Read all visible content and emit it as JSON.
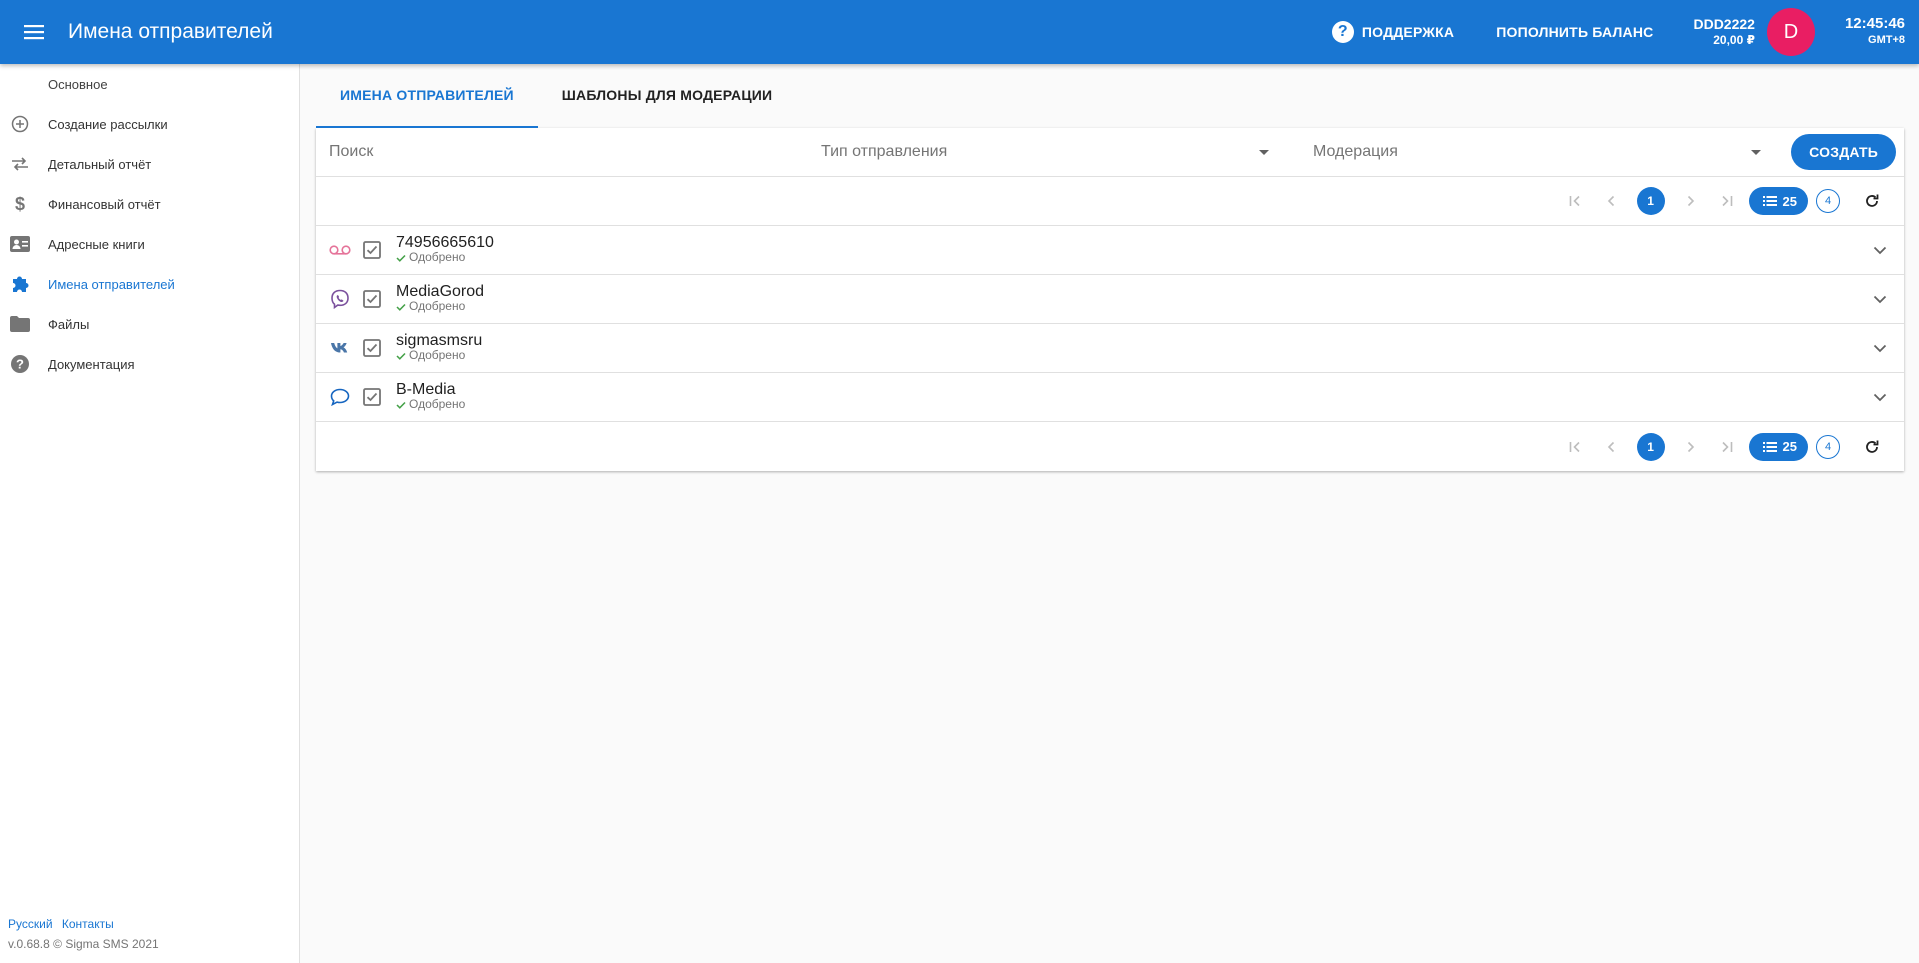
{
  "header": {
    "title": "Имена отправителей",
    "support_label": "ПОДДЕРЖКА",
    "topup_label": "ПОПОЛНИТЬ БАЛАНС",
    "account_login": "DDD2222",
    "account_balance": "20,00 ₽",
    "avatar_letter": "D",
    "time": "12:45:46",
    "timezone": "GMT+8"
  },
  "sidebar": {
    "section": "Основное",
    "items": [
      {
        "label": "Создание рассылки",
        "icon": "add-circle-icon"
      },
      {
        "label": "Детальный отчёт",
        "icon": "swap-arrows-icon"
      },
      {
        "label": "Финансовый отчёт",
        "icon": "dollar-icon"
      },
      {
        "label": "Адресные книги",
        "icon": "contact-card-icon"
      },
      {
        "label": "Имена отправителей",
        "icon": "puzzle-icon",
        "active": true
      },
      {
        "label": "Файлы",
        "icon": "folder-icon"
      },
      {
        "label": "Документация",
        "icon": "help-icon"
      }
    ],
    "footer": {
      "lang": "Русский",
      "contacts": "Контакты",
      "version": "v.0.68.8 © Sigma SMS 2021"
    }
  },
  "tabs": [
    {
      "label": "ИМЕНА ОТПРАВИТЕЛЕЙ",
      "active": true
    },
    {
      "label": "ШАБЛОНЫ ДЛЯ МОДЕРАЦИИ",
      "active": false
    }
  ],
  "filters": {
    "search_placeholder": "Поиск",
    "send_type_placeholder": "Тип отправления",
    "moderation_placeholder": "Модерация",
    "create_label": "СОЗДАТЬ"
  },
  "pagination": {
    "current_page": "1",
    "page_size": "25",
    "total": "4"
  },
  "senders": [
    {
      "name": "74956665610",
      "status": "Одобрено",
      "type_icon": "voicemail-icon",
      "color": "#e57399"
    },
    {
      "name": "MediaGorod",
      "status": "Одобрено",
      "type_icon": "viber-icon",
      "color": "#7b519d"
    },
    {
      "name": "sigmasmsru",
      "status": "Одобрено",
      "type_icon": "vk-icon",
      "color": "#4a76a8"
    },
    {
      "name": "B-Media",
      "status": "Одобрено",
      "type_icon": "sms-bubble-icon",
      "color": "#1565c0"
    }
  ],
  "colors": {
    "primary": "#1976d2",
    "avatar": "#e91e63",
    "approved": "#43a047"
  }
}
